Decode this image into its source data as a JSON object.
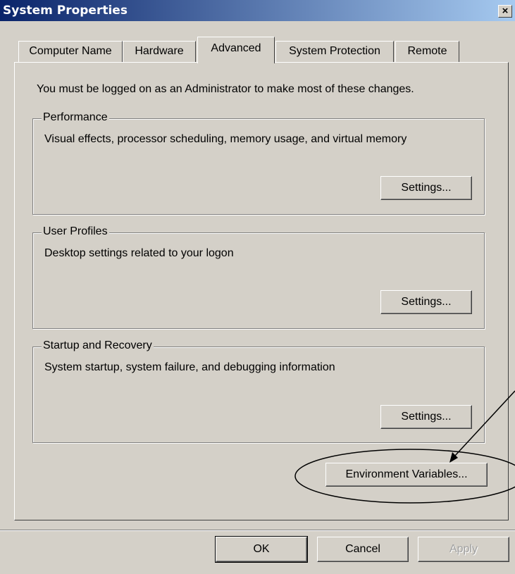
{
  "window": {
    "title": "System Properties",
    "close_label": "×"
  },
  "tabs": [
    {
      "label": "Computer Name"
    },
    {
      "label": "Hardware"
    },
    {
      "label": "Advanced"
    },
    {
      "label": "System Protection"
    },
    {
      "label": "Remote"
    }
  ],
  "notice": "You must be logged on as an Administrator to make most of these changes.",
  "groups": {
    "performance": {
      "title": "Performance",
      "description": "Visual effects, processor scheduling, memory usage, and virtual memory",
      "button": "Settings..."
    },
    "user_profiles": {
      "title": "User Profiles",
      "description": "Desktop settings related to your logon",
      "button": "Settings..."
    },
    "startup": {
      "title": "Startup and Recovery",
      "description": "System startup, system failure, and debugging information",
      "button": "Settings..."
    }
  },
  "env_button": "Environment Variables...",
  "footer": {
    "ok": "OK",
    "cancel": "Cancel",
    "apply": "Apply"
  },
  "colors": {
    "face": "#d4d0c8",
    "title_start": "#0a246a",
    "title_end": "#a6caf0"
  }
}
